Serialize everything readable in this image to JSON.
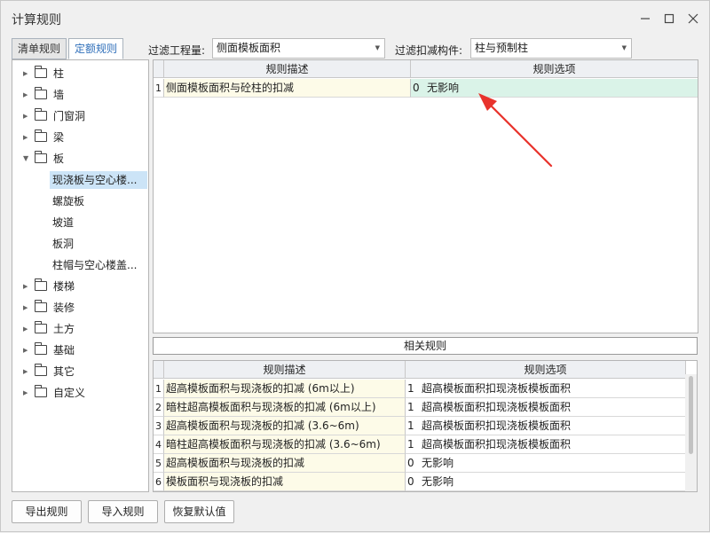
{
  "window": {
    "title": "计算规则"
  },
  "tabs": [
    {
      "label": "清单规则"
    },
    {
      "label": "定额规则"
    }
  ],
  "filters": {
    "quantity_label": "过滤工程量:",
    "quantity_value": "侧面模板面积",
    "component_label": "过滤扣减构件:",
    "component_value": "柱与预制柱"
  },
  "tree": {
    "items": [
      {
        "label": "柱"
      },
      {
        "label": "墙"
      },
      {
        "label": "门窗洞"
      },
      {
        "label": "梁"
      },
      {
        "label": "板"
      },
      {
        "label": "楼梯"
      },
      {
        "label": "装修"
      },
      {
        "label": "土方"
      },
      {
        "label": "基础"
      },
      {
        "label": "其它"
      },
      {
        "label": "自定义"
      }
    ],
    "children": [
      {
        "label": "现浇板与空心楼..."
      },
      {
        "label": "螺旋板"
      },
      {
        "label": "坡道"
      },
      {
        "label": "板洞"
      },
      {
        "label": "柱帽与空心楼盖..."
      }
    ]
  },
  "top_grid": {
    "headers": [
      "规则描述",
      "规则选项"
    ],
    "rows": [
      {
        "num": "1",
        "desc": "侧面模板面积与砼柱的扣减",
        "code": "0",
        "option": "无影响"
      }
    ]
  },
  "related": {
    "label": "相关规则"
  },
  "bottom_grid": {
    "headers": [
      "规则描述",
      "规则选项"
    ],
    "rows": [
      {
        "num": "1",
        "desc": "超高模板面积与现浇板的扣减 (6m以上)",
        "code": "1",
        "option": "超高模板面积扣现浇板模板面积"
      },
      {
        "num": "2",
        "desc": "暗柱超高模板面积与现浇板的扣减 (6m以上)",
        "code": "1",
        "option": "超高模板面积扣现浇板模板面积"
      },
      {
        "num": "3",
        "desc": "超高模板面积与现浇板的扣减 (3.6~6m)",
        "code": "1",
        "option": "超高模板面积扣现浇板模板面积"
      },
      {
        "num": "4",
        "desc": "暗柱超高模板面积与现浇板的扣减 (3.6~6m)",
        "code": "1",
        "option": "超高模板面积扣现浇板模板面积"
      },
      {
        "num": "5",
        "desc": "超高模板面积与现浇板的扣减",
        "code": "0",
        "option": "无影响"
      },
      {
        "num": "6",
        "desc": "模板面积与现浇板的扣减",
        "code": "0",
        "option": "无影响"
      }
    ]
  },
  "buttons": {
    "export": "导出规则",
    "import": "导入规则",
    "restore": "恢复默认值"
  },
  "colors": {
    "accent": "#2f6fba",
    "arrow": "#e8332c",
    "selected": "#cce4f7",
    "row_highlight": "#daf3e8"
  }
}
